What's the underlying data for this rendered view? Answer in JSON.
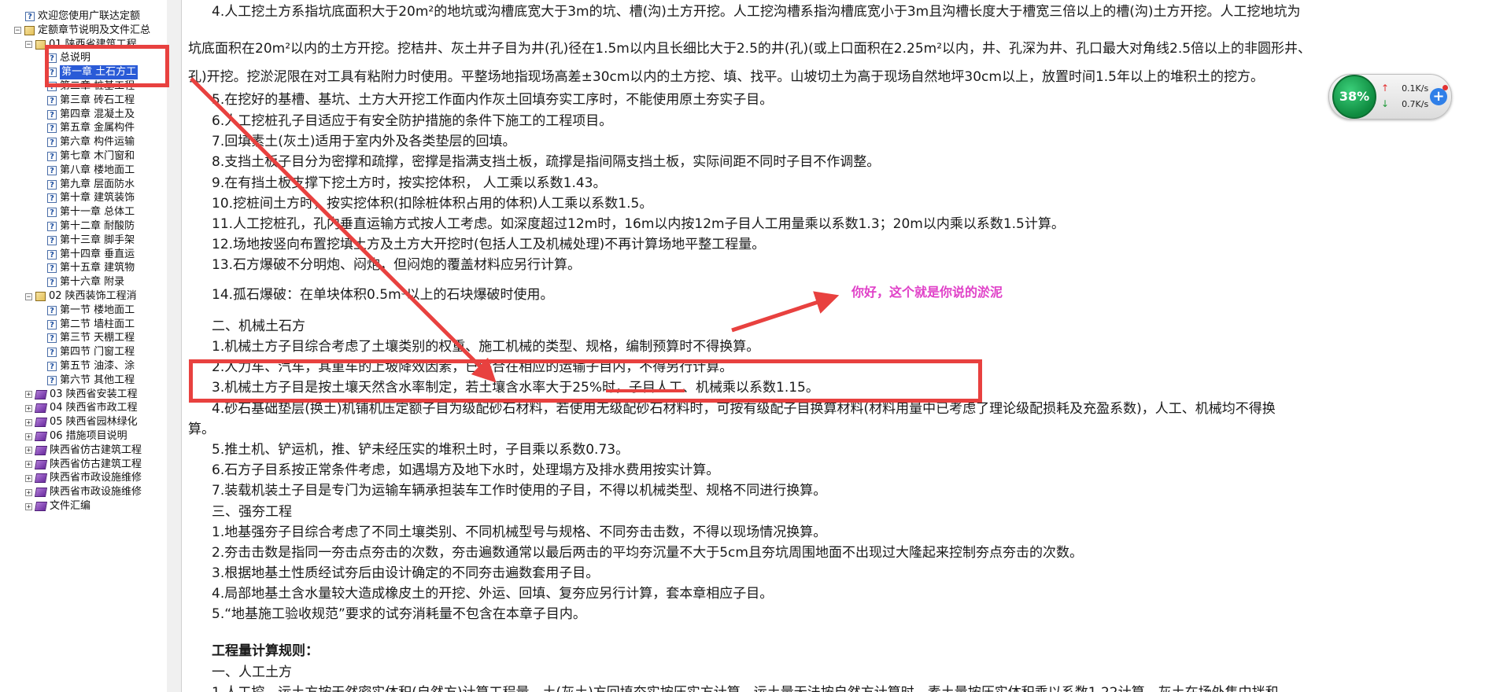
{
  "sidebar": {
    "items": [
      {
        "label": "欢迎您使用广联达定额",
        "icon": "help-icon",
        "expander": ""
      },
      {
        "label": "定额章节说明及文件汇总",
        "icon": "book-icon",
        "expander": "−"
      },
      {
        "label": "01 陕西省建筑工程",
        "icon": "book-icon",
        "expander": "−"
      },
      {
        "label": "总说明",
        "icon": "help-icon",
        "expander": ""
      },
      {
        "label": "第一章 土石方工",
        "icon": "help-icon",
        "expander": "",
        "selected": true
      },
      {
        "label": "第二章 桩基工程",
        "icon": "help-icon",
        "expander": ""
      },
      {
        "label": "第三章 砖石工程",
        "icon": "help-icon",
        "expander": ""
      },
      {
        "label": "第四章 混凝土及",
        "icon": "help-icon",
        "expander": ""
      },
      {
        "label": "第五章 金属构件",
        "icon": "help-icon",
        "expander": ""
      },
      {
        "label": "第六章 构件运输",
        "icon": "help-icon",
        "expander": ""
      },
      {
        "label": "第七章 木门窗和",
        "icon": "help-icon",
        "expander": ""
      },
      {
        "label": "第八章 楼地面工",
        "icon": "help-icon",
        "expander": ""
      },
      {
        "label": "第九章 层面防水",
        "icon": "help-icon",
        "expander": ""
      },
      {
        "label": "第十章 建筑装饰",
        "icon": "help-icon",
        "expander": ""
      },
      {
        "label": "第十一章 总体工",
        "icon": "help-icon",
        "expander": ""
      },
      {
        "label": "第十二章 耐酸防",
        "icon": "help-icon",
        "expander": ""
      },
      {
        "label": "第十三章 脚手架",
        "icon": "help-icon",
        "expander": ""
      },
      {
        "label": "第十四章 垂直运",
        "icon": "help-icon",
        "expander": ""
      },
      {
        "label": "第十五章 建筑物",
        "icon": "help-icon",
        "expander": ""
      },
      {
        "label": "第十六章 附录",
        "icon": "help-icon",
        "expander": ""
      },
      {
        "label": "02 陕西装饰工程消",
        "icon": "book-icon",
        "expander": "−"
      },
      {
        "label": "第一节 楼地面工",
        "icon": "help-icon",
        "expander": ""
      },
      {
        "label": "第二节 墙柱面工",
        "icon": "help-icon",
        "expander": ""
      },
      {
        "label": "第三节 天棚工程",
        "icon": "help-icon",
        "expander": ""
      },
      {
        "label": "第四节 门窗工程",
        "icon": "help-icon",
        "expander": ""
      },
      {
        "label": "第五节 油漆、涂",
        "icon": "help-icon",
        "expander": ""
      },
      {
        "label": "第六节 其他工程",
        "icon": "help-icon",
        "expander": ""
      },
      {
        "label": "03 陕西省安装工程",
        "icon": "purple-book-icon",
        "expander": "+"
      },
      {
        "label": "04 陕西省市政工程",
        "icon": "purple-book-icon",
        "expander": "+"
      },
      {
        "label": "05 陕西省园林绿化",
        "icon": "purple-book-icon",
        "expander": "+"
      },
      {
        "label": "06 措施项目说明",
        "icon": "purple-book-icon",
        "expander": "+"
      },
      {
        "label": "陕西省仿古建筑工程",
        "icon": "purple-book-icon",
        "expander": "+"
      },
      {
        "label": "陕西省仿古建筑工程",
        "icon": "purple-book-icon",
        "expander": "+"
      },
      {
        "label": "陕西省市政设施维修",
        "icon": "purple-book-icon",
        "expander": "+"
      },
      {
        "label": "陕西省市政设施维修",
        "icon": "purple-book-icon",
        "expander": "+"
      },
      {
        "label": "文件汇编",
        "icon": "purple-book-icon",
        "expander": "+"
      }
    ]
  },
  "content": {
    "lines": [
      "4.人工挖土方系指坑底面积大于20m²的地坑或沟槽底宽大于3m的坑、槽(沟)土方开挖。人工挖沟槽系指沟槽底宽小于3m且沟槽长度大于槽宽三倍以上的槽(沟)土方开挖。人工挖地坑为",
      "坑底面积在20m²以内的土方开挖。挖桔井、灰土井子目为井(孔)径在1.5m以内且长细比大于2.5的井(孔)(或上口面积在2.25m²以内，井、孔深为井、孔口最大对角线2.5倍以上的非圆形井、",
      "孔)开挖。挖淤泥限在对工具有粘附力时使用。平整场地指现场高差±30cm以内的土方挖、填、找平。山坡切土为高于现场自然地坪30cm以上，放置时间1.5年以上的堆积土的挖方。",
      "5.在挖好的基槽、基坑、土方大开挖工作面内作灰土回填夯实工序时，不能使用原土夯实子目。",
      "6.人工挖桩孔子目适应于有安全防护措施的条件下施工的工程项目。",
      "7.回填素土(灰土)适用于室内外及各类垫层的回填。",
      "8.支挡土板子目分为密撑和疏撑，密撑是指满支挡土板，疏撑是指间隔支挡土板，实际间距不同时子目不作调整。",
      "9.在有挡土板支撑下挖土方时，按实挖体积， 人工乘以系数1.43。",
      "10.挖桩间土方时，按实挖体积(扣除桩体积占用的体积)人工乘以系数1.5。",
      "11.人工挖桩孔，孔内垂直运输方式按人工考虑。如深度超过12m时，16m以内按12m子目人工用量乘以系数1.3；20m以内乘以系数1.5计算。",
      "12.场地按竖向布置挖填土方及土方大开挖时(包括人工及机械处理)不再计算场地平整工程量。",
      "13.石方爆破不分明炮、闷炮，但闷炮的覆盖材料应另行计算。",
      "14.孤石爆破：在单块体积0.5m³以上的石块爆破时使用。",
      "二、机械土石方",
      "1.机械土方子目综合考虑了土壤类别的权重、施工机械的类型、规格，编制预算时不得换算。",
      "2.人力车、汽车，其重车的上坡降效因素，已综合在相应的运输子目内，不得另行计算。",
      "3.机械土方子目是按土壤天然含水率制定，若土壤含水率大于25%时，子目人工、机械乘以系数1.15。",
      "4.砂石基础垫层(换土)机铺机压定额子目为级配砂石材料，若使用无级配砂石材料时，可按有级配子目换算材料(材料用量中已考虑了理论级配损耗及充盈系数)，人工、机械均不得换",
      "算。",
      "5.推土机、铲运机，推、铲未经压实的堆积土时，子目乘以系数0.73。",
      "6.石方子目系按正常条件考虑，如遇塌方及地下水时，处理塌方及排水费用按实计算。",
      "7.装载机装土子目是专门为运输车辆承担装车工作时使用的子目，不得以机械类型、规格不同进行换算。",
      "三、强夯工程",
      "1.地基强夯子目综合考虑了不同土壤类别、不同机械型号与规格、不同夯击击数，不得以现场情况换算。",
      "2.夯击击数是指同一夯击点夯击的次数，夯击遍数通常以最后两击的平均夯沉量不大于5cm且夯坑周围地面不出现过大隆起来控制夯点夯击的次数。",
      "3.根据地基土性质经试夯后由设计确定的不同夯击遍数套用子目。",
      "4.局部地基土含水量较大造成橡皮土的开挖、外运、回填、复夯应另行计算，套本章相应子目。",
      "5.“地基施工验收规范”要求的试夯消耗量不包含在本章子目内。",
      "工程量计算规则：",
      "一、人工土方",
      "1.人工挖、运土方按天然密实体积(自然方)计算工程量。土(灰土)方回填夯实按压实方计算。运土量无法按自然方计算时，素土量按压实体积乘以系数1.22计算，灰土在场外集中拌和"
    ]
  },
  "annotation": {
    "text": "你好，这个就是你说的淤泥",
    "color": "#e040c8",
    "box_color": "#e8413f"
  },
  "net_widget": {
    "percent": "38%",
    "upload": "0.1K/s",
    "download": "0.7K/s"
  }
}
